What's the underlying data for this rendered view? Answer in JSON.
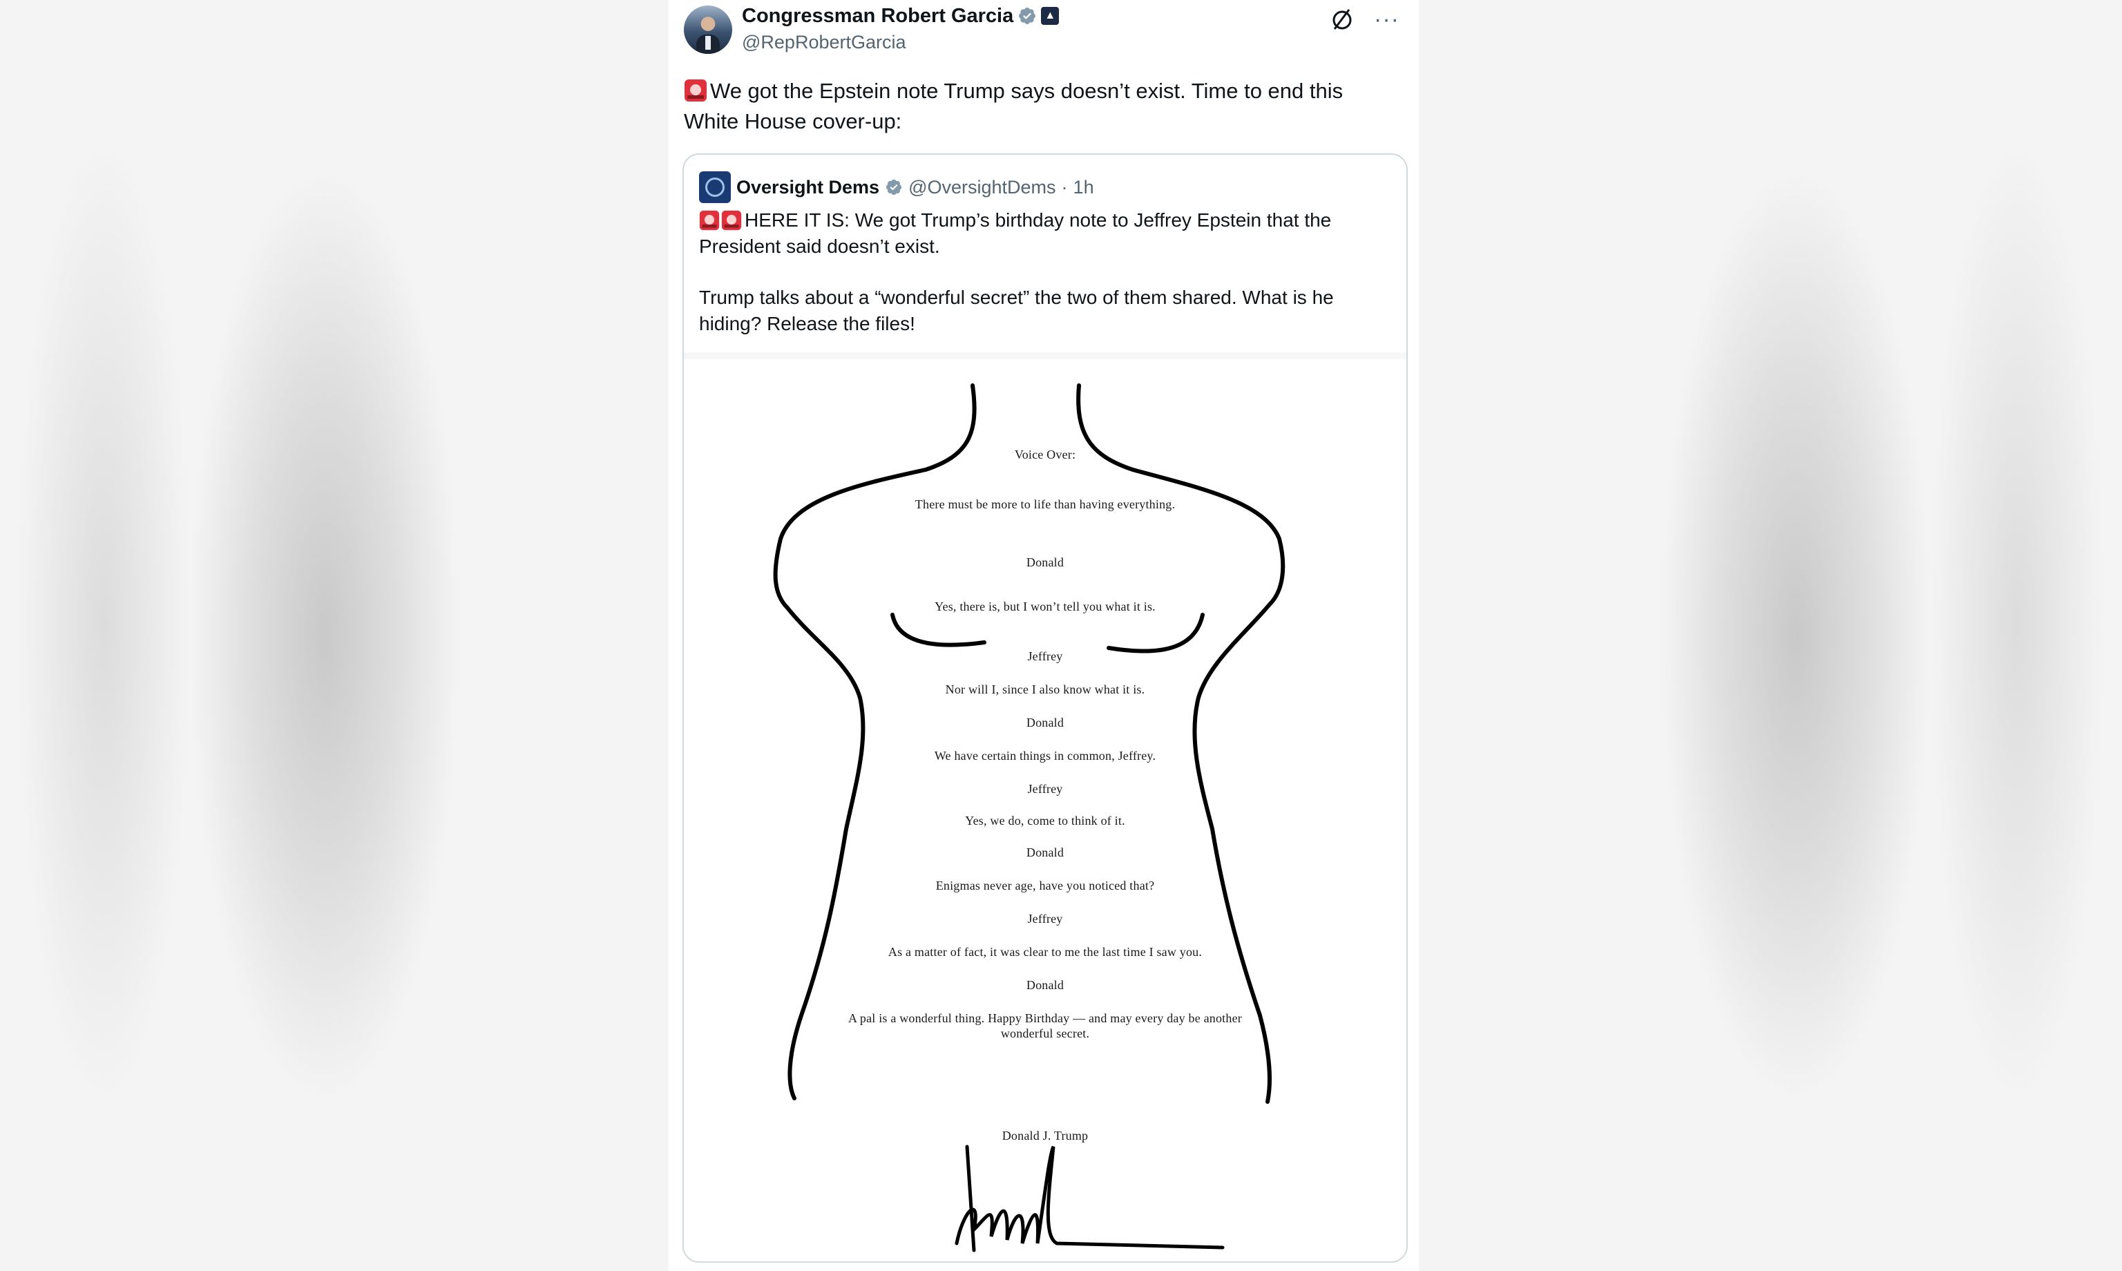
{
  "author": {
    "name": "Congressman Robert Garcia",
    "handle": "@RepRobertGarcia"
  },
  "tweet": {
    "text": "We got the Epstein note Trump says doesn’t exist. Time to end this White House cover-up:"
  },
  "quoted": {
    "name": "Oversight Dems",
    "handle": "@OversightDems",
    "separator": "·",
    "time": "1h",
    "paragraph1": "HERE IT IS: We got Trump’s birthday note to Jeffrey Epstein that the President said doesn’t exist.",
    "paragraph2": "Trump talks about a “wonderful secret” the two of them shared. What is he hiding? Release the files!"
  },
  "note": {
    "lines": [
      "Voice Over:",
      "There must be more to life than having everything.",
      "Donald",
      "Yes, there is, but I won’t tell you what it is.",
      "Jeffrey",
      "Nor will I, since I also know what it is.",
      "Donald",
      "We have certain things in common, Jeffrey.",
      "Jeffrey",
      "Yes, we do, come to think of it.",
      "Donald",
      "Enigmas never age, have you noticed that?",
      "Jeffrey",
      "As a matter of fact, it was clear to me the last time I saw you.",
      "Donald",
      "A pal is a wonderful thing. Happy Birthday — and may every day be another",
      "wonderful secret.",
      "Donald J. Trump"
    ]
  },
  "colors": {
    "text": "#0f1419",
    "muted": "#536471",
    "verified": "#829aab",
    "border": "#cfd9de",
    "siren": "#e0303b"
  },
  "icons": {
    "verified": "verified-badge-icon",
    "grok": "grok-icon",
    "more": "more-options-icon",
    "siren": "police-siren-emoji"
  }
}
